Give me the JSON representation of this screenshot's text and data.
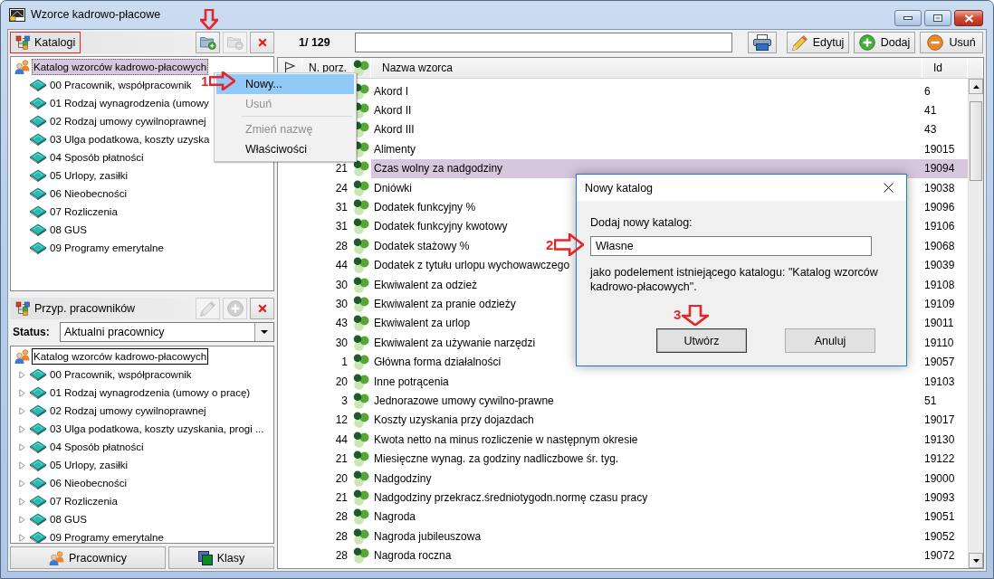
{
  "window": {
    "title": "Wzorce kadrowo-płacowe"
  },
  "catalogs": {
    "header": {
      "label": "Katalogi",
      "selected": true
    },
    "tools": [
      {
        "kind": "folder-add",
        "disabled": false
      },
      {
        "kind": "folder-remove",
        "disabled": true
      },
      {
        "kind": "delete",
        "disabled": false
      }
    ],
    "tree": {
      "label": "Katalog wzorców kadrowo-płacowych",
      "selected": true,
      "children": [
        {
          "label": "00 Pracownik, współpracownik",
          "selected": false
        },
        {
          "label": "01 Rodzaj wynagrodzenia (umowy",
          "selected": false
        },
        {
          "label": "02 Rodzaj umowy cywilnoprawnej",
          "selected": false
        },
        {
          "label": "03 Ulga podatkowa, koszty uzyska",
          "selected": false
        },
        {
          "label": "04 Sposób płatności",
          "selected": false
        },
        {
          "label": "05 Urlopy, zasiłki",
          "selected": false
        },
        {
          "label": "06 Nieobecności",
          "selected": false
        },
        {
          "label": "07 Rozliczenia",
          "selected": false
        },
        {
          "label": "08 GUS",
          "selected": false
        },
        {
          "label": "09 Programy emerytalne",
          "selected": false
        }
      ]
    }
  },
  "assignment": {
    "header": {
      "label": "Przyp. pracowników",
      "selected": false
    },
    "tools": [
      {
        "kind": "edit",
        "disabled": true
      },
      {
        "kind": "add",
        "disabled": true
      },
      {
        "kind": "delete",
        "disabled": false
      }
    ],
    "status": {
      "label": "Status:",
      "value": "Aktualni pracownicy"
    },
    "tree": {
      "label": "Katalog wzorców kadrowo-płacowych",
      "selected": false,
      "focused": true,
      "children": [
        {
          "label": "00 Pracownik, współpracownik",
          "selected": false,
          "expanded": false
        },
        {
          "label": "01 Rodzaj wynagrodzenia (umowy o pracę)",
          "selected": false,
          "expanded": false
        },
        {
          "label": "02 Rodzaj umowy cywilnoprawnej",
          "selected": false,
          "expanded": false
        },
        {
          "label": "03 Ulga podatkowa, koszty uzyskania, progi ...",
          "selected": false,
          "expanded": false
        },
        {
          "label": "04 Sposób płatności",
          "selected": false,
          "expanded": false
        },
        {
          "label": "05 Urlopy, zasiłki",
          "selected": false,
          "expanded": false
        },
        {
          "label": "06 Nieobecności",
          "selected": false,
          "expanded": false
        },
        {
          "label": "07 Rozliczenia",
          "selected": false,
          "expanded": false
        },
        {
          "label": "08 GUS",
          "selected": false,
          "expanded": false
        },
        {
          "label": "09 Programy emerytalne",
          "selected": false,
          "expanded": false
        }
      ]
    },
    "buttons": [
      {
        "kind": "people",
        "label": "Pracownicy"
      },
      {
        "kind": "classes",
        "label": "Klasy"
      }
    ]
  },
  "list": {
    "counter": "1/ 129",
    "actions": [
      {
        "kind": "print"
      },
      {
        "kind": "edit",
        "label": "Edytuj"
      },
      {
        "kind": "add",
        "label": "Dodaj"
      },
      {
        "kind": "remove",
        "label": "Usuń"
      }
    ],
    "table": {
      "columns": [
        {
          "kind": "flag"
        },
        {
          "kind": "number",
          "label": "N. porz."
        },
        {
          "kind": "icon"
        },
        {
          "kind": "name",
          "label": "Nazwa wzorca"
        },
        {
          "kind": "id",
          "label": "Id"
        }
      ],
      "rows": [
        {
          "name": "Akord I",
          "id": "6",
          "selected": false
        },
        {
          "name": "Akord II",
          "id": "41",
          "selected": false
        },
        {
          "name": "Akord III",
          "id": "43",
          "selected": false
        },
        {
          "name": "Alimenty",
          "id": "19015",
          "selected": false
        },
        {
          "number": "21",
          "name": "Czas wolny za nadgodziny",
          "id": "19094",
          "selected": true
        },
        {
          "number": "24",
          "name": "Dniówki",
          "id": "19038",
          "selected": false
        },
        {
          "number": "31",
          "name": "Dodatek funkcyjny %",
          "id": "19096",
          "selected": false
        },
        {
          "number": "31",
          "name": "Dodatek funkcyjny kwotowy",
          "id": "19106",
          "selected": false
        },
        {
          "number": "28",
          "name": "Dodatek stażowy %",
          "id": "19068",
          "selected": false
        },
        {
          "number": "44",
          "name": "Dodatek z tytułu urlopu wychowawczego",
          "id": "19039",
          "selected": false
        },
        {
          "number": "30",
          "name": "Ekwiwalent za odzież",
          "id": "19108",
          "selected": false
        },
        {
          "number": "30",
          "name": "Ekwiwalent za pranie odzieży",
          "id": "19109",
          "selected": false
        },
        {
          "number": "43",
          "name": "Ekwiwalent za urlop",
          "id": "19011",
          "selected": false
        },
        {
          "number": "30",
          "name": "Ekwiwalent za używanie narzędzi",
          "id": "19110",
          "selected": false
        },
        {
          "number": "1",
          "name": "Główna forma działalności",
          "id": "19057",
          "selected": false
        },
        {
          "number": "20",
          "name": "Inne potrącenia",
          "id": "19103",
          "selected": false
        },
        {
          "number": "3",
          "name": "Jednorazowe umowy cywilno-prawne",
          "id": "51",
          "selected": false
        },
        {
          "number": "12",
          "name": "Koszty uzyskania przy dojazdach",
          "id": "19017",
          "selected": false
        },
        {
          "number": "44",
          "name": "Kwota netto na minus rozliczenie w następnym okresie",
          "id": "19130",
          "selected": false
        },
        {
          "number": "21",
          "name": "Miesięczne wynag. za godziny nadliczbowe śr. tyg.",
          "id": "19122",
          "selected": false
        },
        {
          "number": "20",
          "name": "Nadgodziny",
          "id": "19000",
          "selected": false
        },
        {
          "number": "21",
          "name": "Nadgodziny przekracz.średniotygodn.normę czasu pracy",
          "id": "19093",
          "selected": false
        },
        {
          "number": "28",
          "name": "Nagroda",
          "id": "19051",
          "selected": false
        },
        {
          "number": "28",
          "name": "Nagroda jubileuszowa",
          "id": "19052",
          "selected": false
        },
        {
          "number": "28",
          "name": "Nagroda roczna",
          "id": "19072",
          "selected": false
        }
      ]
    }
  },
  "context_menu": {
    "items": [
      {
        "kind": "item",
        "label": "Nowy...",
        "selected": true,
        "disabled": false
      },
      {
        "kind": "item",
        "label": "Usuń",
        "selected": false,
        "disabled": true
      },
      {
        "kind": "separator"
      },
      {
        "kind": "item",
        "label": "Zmień nazwę",
        "selected": false,
        "disabled": true
      },
      {
        "kind": "item",
        "label": "Właściwości",
        "selected": false,
        "disabled": false
      }
    ]
  },
  "dialog": {
    "title": "Nowy katalog",
    "prompt": "Dodaj nowy katalog:",
    "value": "Własne",
    "note": "jako podelement istniejącego katalogu: \"Katalog wzorców kadrowo-płacowych\".",
    "buttons": [
      {
        "label": "Utwórz",
        "default": true
      },
      {
        "label": "Anuluj",
        "default": false
      }
    ]
  },
  "annotations": [
    {
      "kind": "arrow-down"
    },
    {
      "kind": "arrow-right",
      "label": "1"
    },
    {
      "kind": "arrow-right",
      "label": "2"
    },
    {
      "kind": "arrow-down",
      "label": "3"
    }
  ]
}
